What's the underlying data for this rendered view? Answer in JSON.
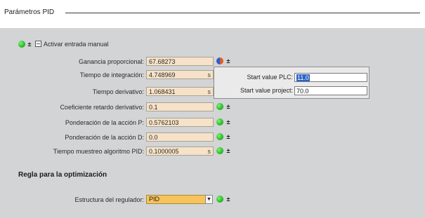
{
  "section": {
    "title": "Parámetros PID"
  },
  "manual": {
    "label": "Activar entrada manual"
  },
  "params": [
    {
      "label": "Ganancia proporcional:",
      "value": "67.68273",
      "unit": ""
    },
    {
      "label": "Tiempo de integración:",
      "value": "4.748969",
      "unit": "s"
    },
    {
      "label": "Tiempo derivativo:",
      "value": "1.068431",
      "unit": "s"
    },
    {
      "label": "Coeficiente retardo derivativo:",
      "value": "0.1",
      "unit": ""
    },
    {
      "label": "Ponderación de la acción P:",
      "value": "0.5762103",
      "unit": ""
    },
    {
      "label": "Ponderación de la acción D:",
      "value": "0.0",
      "unit": ""
    },
    {
      "label": "Tiempo muestreo algoritmo PID:",
      "value": "0.1000005",
      "unit": "s"
    }
  ],
  "popup": {
    "plc_label": "Start value PLC:",
    "plc_value": "11.0",
    "project_label": "Start value project:",
    "project_value": "70.0"
  },
  "optimization": {
    "heading": "Regla para la optimización",
    "regulator_label": "Estructura del regulador:",
    "regulator_value": "PID"
  },
  "icons": {
    "status_ok": "green-status-icon",
    "status_mixed": "mixed-status-icon",
    "plusminus": "plus-minus-icon",
    "dropdown": "dropdown-arrow-icon"
  },
  "colors": {
    "field_bg": "#f6e2c8",
    "combo_bg": "#f7c35b",
    "selection": "#2d62c4",
    "status_green": "#2fc02a"
  }
}
